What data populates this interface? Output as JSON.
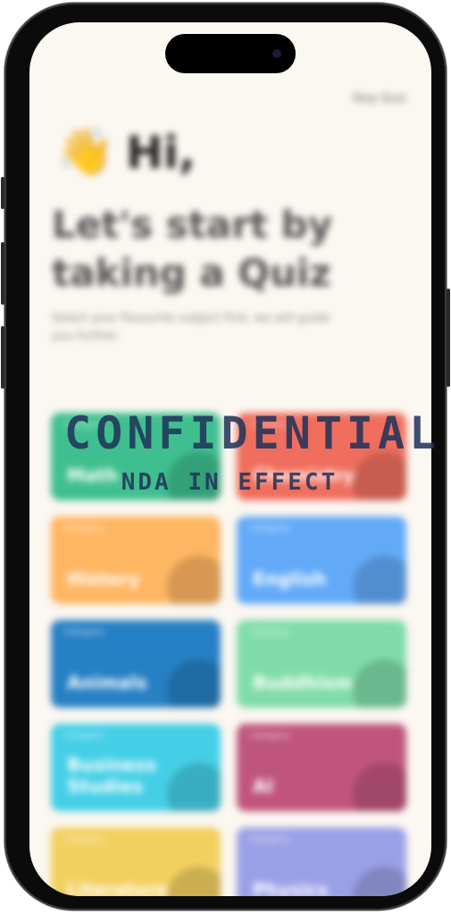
{
  "header": {
    "link_label": "Skip Quiz"
  },
  "greeting": {
    "emoji": "👋",
    "title": "Hi,"
  },
  "heading": "Let's start by taking a Quiz",
  "subtitle": "Select your Favourite subject first, we will guide you further.",
  "watermark": {
    "line1": "CONFIDENTIAL",
    "line2": "NDA IN EFFECT"
  },
  "cards": [
    {
      "caption": "Category",
      "name": "Math",
      "color": "#3fbf8f"
    },
    {
      "caption": "Category",
      "name": "Chemistry",
      "color": "#ef6e5d"
    },
    {
      "caption": "Category",
      "name": "History",
      "color": "#ffb662"
    },
    {
      "caption": "Category",
      "name": "English",
      "color": "#62aaf7"
    },
    {
      "caption": "Category",
      "name": "Animals",
      "color": "#2680c4"
    },
    {
      "caption": "Category",
      "name": "Buddhism",
      "color": "#7fdca8"
    },
    {
      "caption": "Category",
      "name": "Business Studies",
      "color": "#44cfe6"
    },
    {
      "caption": "Category",
      "name": "AI",
      "color": "#c0557c"
    },
    {
      "caption": "Category",
      "name": "Literature",
      "color": "#f2d060"
    },
    {
      "caption": "Category",
      "name": "Physics",
      "color": "#9aa0e6"
    }
  ]
}
